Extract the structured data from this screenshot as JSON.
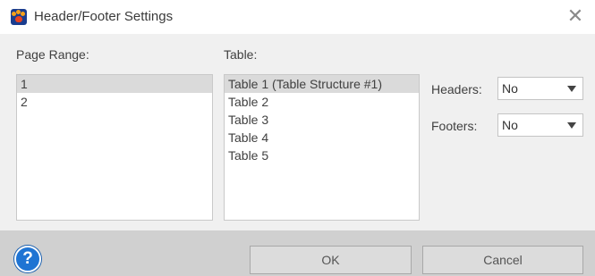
{
  "window": {
    "title": "Header/Footer Settings",
    "close_glyph": "✕"
  },
  "page_range": {
    "label": "Page Range:",
    "items": [
      "1",
      "2"
    ],
    "selected_index": 0
  },
  "table": {
    "label": "Table:",
    "items": [
      "Table 1 (Table Structure #1)",
      "Table 2",
      "Table 3",
      "Table 4",
      "Table 5"
    ],
    "selected_index": 0
  },
  "headers": {
    "label": "Headers:",
    "value": "No"
  },
  "footers": {
    "label": "Footers:",
    "value": "No"
  },
  "buttons": {
    "help_glyph": "?",
    "ok": "OK",
    "cancel": "Cancel"
  },
  "colors": {
    "help_blue": "#1f74d3",
    "selected_row": "#dadada",
    "footer_bg": "#d0d0d0"
  }
}
